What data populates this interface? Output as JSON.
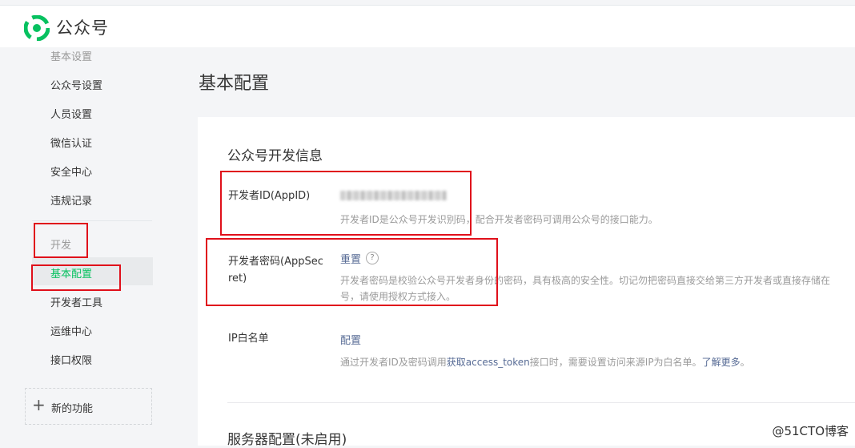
{
  "header": {
    "brand": "公众号",
    "brand_color": "#07c160",
    "logo_icon": "wechat-mp-logo"
  },
  "sidebar": {
    "group_basic": "基本设置",
    "items_basic": [
      "公众号设置",
      "人员设置",
      "微信认证",
      "安全中心",
      "违规记录"
    ],
    "group_dev": "开发",
    "items_dev": [
      "基本配置",
      "开发者工具",
      "运维中心",
      "接口权限"
    ],
    "active_item": "基本配置",
    "new_feature": {
      "icon": "plus-icon",
      "label": "新的功能"
    }
  },
  "main": {
    "page_title": "基本配置",
    "section_title": "公众号开发信息",
    "appid": {
      "label": "开发者ID(AppID)",
      "desc": "开发者ID是公众号开发识别码，配合开发者密码可调用公众号的接口能力。"
    },
    "secret": {
      "label_line1": "开发者密码(AppSec",
      "label_line2": "ret)",
      "action": "重置",
      "help_icon": "question-circle-icon",
      "help_glyph": "?",
      "desc_line1": "开发者密码是校验公众号开发者身份的密码，具有极高的安全性。切记勿把密码直接交给第三方开发者或直接存储在",
      "desc_line2": "号，请使用授权方式接入。"
    },
    "ip_whitelist": {
      "label": "IP白名单",
      "action": "配置",
      "desc_prefix": "通过开发者ID及密码调用",
      "desc_link1": "获取access_token",
      "desc_middle": "接口时，需要设置访问来源IP为白名单。",
      "desc_link2": "了解更多",
      "desc_suffix": "。"
    },
    "next_section_title": "服务器配置(未启用)"
  },
  "watermark": "@51CTO博客",
  "annotation_color": "#e0101b"
}
